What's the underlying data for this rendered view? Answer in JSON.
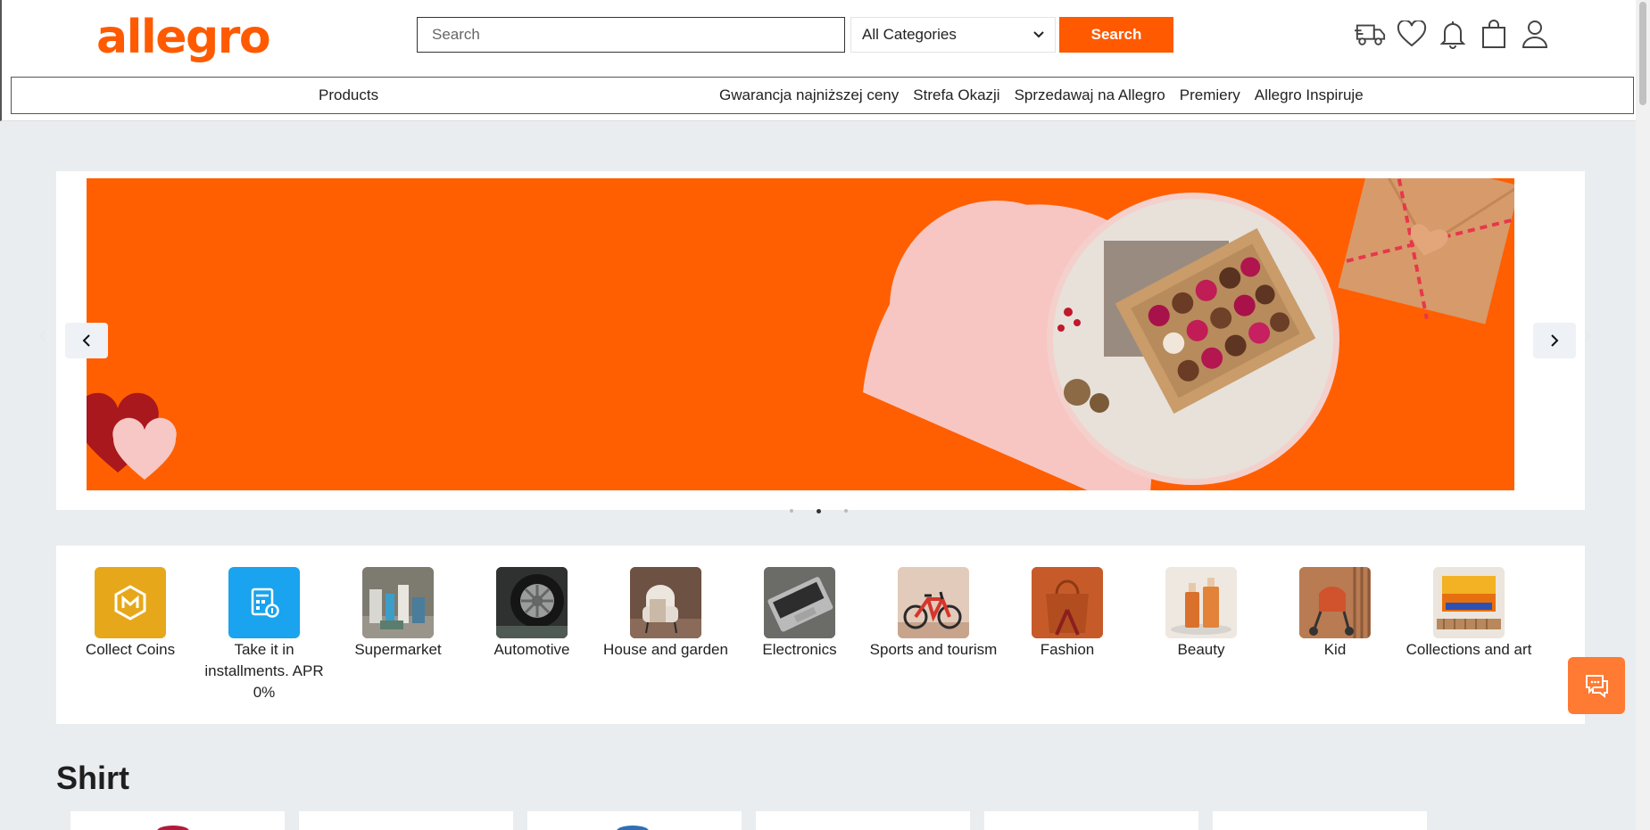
{
  "header": {
    "logo": "allegro",
    "search_placeholder": "Search",
    "category_selected": "All Categories",
    "search_button": "Search",
    "icons": [
      "truck-icon",
      "heart-icon",
      "bell-icon",
      "bag-icon",
      "user-icon"
    ]
  },
  "nav": {
    "products": "Products",
    "links": [
      "Gwarancja najniższej ceny",
      "Strefa Okazji",
      "Sprzedawaj na Allegro",
      "Premiery",
      "Allegro Inspiruje"
    ]
  },
  "carousel": {
    "active_slide": 2,
    "slide_count": 3
  },
  "categories": [
    {
      "label": "Collect Coins"
    },
    {
      "label": "Take it in installments. APR 0%"
    },
    {
      "label": "Supermarket"
    },
    {
      "label": "Automotive"
    },
    {
      "label": "House and garden"
    },
    {
      "label": "Electronics"
    },
    {
      "label": "Sports and tourism"
    },
    {
      "label": "Fashion"
    },
    {
      "label": "Beauty"
    },
    {
      "label": "Kid"
    },
    {
      "label": "Collections and art"
    }
  ],
  "section": {
    "title": "Shirt"
  },
  "colors": {
    "brand": "#ff5a00",
    "page_bg": "#eaedf0"
  }
}
